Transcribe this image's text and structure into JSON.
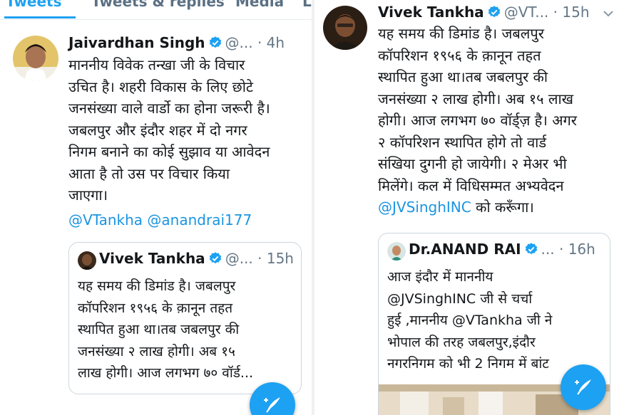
{
  "tabs": [
    {
      "label": "Tweets",
      "active": true
    },
    {
      "label": "Tweets & replies",
      "active": false
    },
    {
      "label": "Media",
      "active": false
    },
    {
      "label": "L",
      "active": false
    }
  ],
  "left_tweet": {
    "name": "Jaivardhan Singh",
    "handle": "@...",
    "separator": "·",
    "time": "4h",
    "lines": [
      "माननीय विवेक तन्खा जी के विचार",
      "उचित है। शहरी विकास के लिए छोटे",
      "जनसंख्या वाले वार्डो का होना जरूरी है।",
      "जबलपुर और इंदौर शहर में दो नगर",
      "निगम बनाने का कोई सुझाव या आवेदन",
      "आता है तो उस पर विचार किया",
      "जाएगा।"
    ],
    "mentions": [
      "@VTankha",
      "@anandrai177"
    ],
    "quote": {
      "name": "Vivek Tankha",
      "handle": "@...",
      "separator": "·",
      "time": "15h",
      "lines": [
        "यह समय की डिमांड है। जबलपुर",
        "कॉपरिशन १९५६ के क़ानून तहत",
        "स्थापित हुआ था।तब जबलपुर की",
        "जनसंख्या २ लाख होगी। अब १५",
        "लाख होगी। आज लगभग ७० वॉर्ड..."
      ]
    }
  },
  "right_tweet": {
    "name": "Vivek Tankha",
    "handle": "@VT...",
    "separator": "·",
    "time": "15h",
    "lines": [
      "यह समय की डिमांड है। जबलपुर",
      "कॉपरिशन १९५६ के क़ानून तहत",
      "स्थापित हुआ था।तब जबलपुर की",
      "जनसंख्या २ लाख होगी। अब १५ लाख",
      "होगी। आज लगभग ७० वॉर्ड्ज़ है। अगर",
      "२ कॉपरिशन स्थापित होगे तो वार्ड",
      "संखिया दुगनी हो जायेगी। २ मेअर भी",
      "मिलेंगे। कल में विधिसम्मत अभ्यवेदन"
    ],
    "last_line_mention": "@JVSinghINC",
    "last_line_rest": " को करूँगा।",
    "quote": {
      "name": "Dr.ANAND RAI",
      "handle": "...",
      "separator": "·",
      "time": "16h",
      "lines": [
        "आज इंदौर में माननीय",
        "@JVSinghINC जी से चर्चा",
        "हुई ,माननीय @VTankha जी ने",
        "भोपाल की तरह जबलपुर,इंदौर",
        "नगरनिगम को भी 2 निगम में बांट"
      ]
    }
  },
  "colors": {
    "accent": "#1da1f2",
    "mention": "#1b95e0",
    "muted": "#657786"
  }
}
